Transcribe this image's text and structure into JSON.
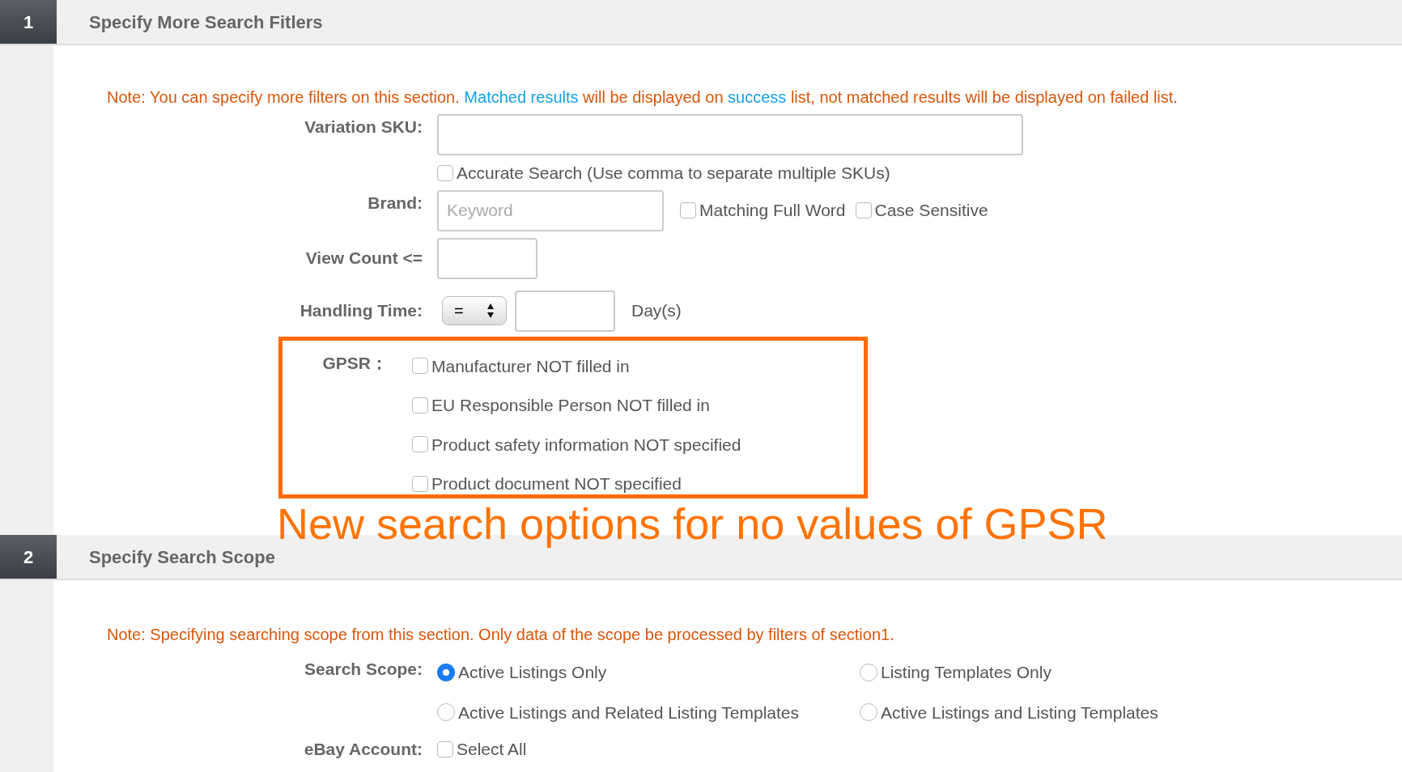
{
  "section_1": {
    "number": "1",
    "title": "Specify More Search Fitlers",
    "note": [
      {
        "kind": "text",
        "text": "Note: You can specify more filters on this section. "
      },
      {
        "kind": "link",
        "text": "Matched results"
      },
      {
        "kind": "text",
        "text": " will be displayed on "
      },
      {
        "kind": "link",
        "text": "success"
      },
      {
        "kind": "text",
        "text": " list, not matched results will be displayed on failed list."
      }
    ],
    "variation_sku": {
      "label": "Variation SKU:",
      "accurate_search": {
        "label": "Accurate Search (Use comma to separate multiple SKUs)",
        "checked": false
      }
    },
    "brand": {
      "label": "Brand:",
      "placeholder": "Keyword",
      "options": [
        {
          "label": "Matching Full Word",
          "checked": false
        },
        {
          "label": "Case Sensitive",
          "checked": false
        }
      ]
    },
    "view_count": {
      "label": "View Count <="
    },
    "handling_time": {
      "label": "Handling Time:",
      "operator": "=",
      "unit": "Day(s)"
    },
    "gpsr": {
      "label": "GPSR：",
      "options": [
        {
          "label": "Manufacturer NOT filled in",
          "checked": false
        },
        {
          "label": "EU Responsible Person NOT filled in",
          "checked": false
        },
        {
          "label": "Product safety information NOT specified",
          "checked": false
        },
        {
          "label": "Product document NOT specified",
          "checked": false
        }
      ]
    }
  },
  "annotation": "New search options for no values of GPSR",
  "section_2": {
    "number": "2",
    "title": "Specify Search Scope",
    "note": [
      {
        "kind": "text",
        "text": "Note: Specifying searching scope from this section. Only data of the scope be processed by filters of section1."
      }
    ],
    "search_scope": {
      "label": "Search Scope:",
      "options": [
        {
          "label": "Active Listings Only",
          "selected": true
        },
        {
          "label": "Listing Templates Only",
          "selected": false
        },
        {
          "label": "Active Listings and Related Listing Templates",
          "selected": false
        },
        {
          "label": "Active Listings and Listing Templates",
          "selected": false
        }
      ]
    },
    "ebay_account": {
      "label": "eBay Account:",
      "select_all": {
        "label": "Select All",
        "checked": false
      }
    }
  }
}
